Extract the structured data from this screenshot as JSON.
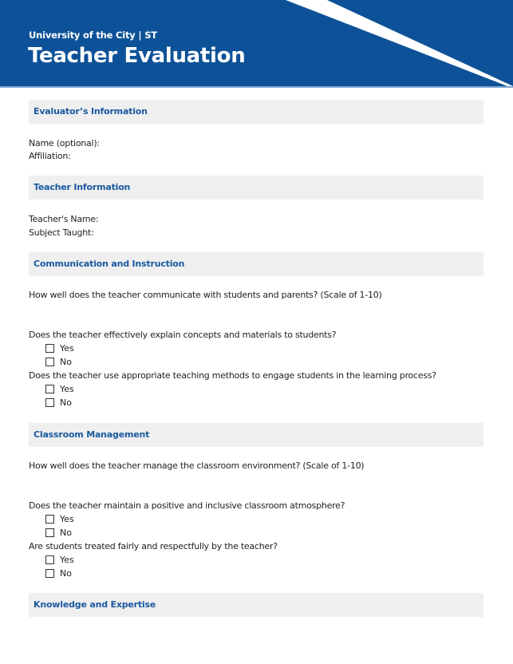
{
  "header": {
    "subtitle": "University of the City | ST",
    "title": "Teacher Evaluation",
    "brand_color": "#0d5298"
  },
  "sections": [
    {
      "title": "Evaluator’s Information",
      "fields": [
        "Name (optional):",
        "Affiliation:"
      ]
    },
    {
      "title": "Teacher Information",
      "fields": [
        "Teacher's Name:",
        "Subject Taught:"
      ]
    },
    {
      "title": "Communication and Instruction",
      "scale_question": "How well does the teacher communicate with students and parents? (Scale of 1-10)",
      "questions": [
        {
          "text": "Does the teacher effectively explain concepts and materials to students?",
          "options": [
            "Yes",
            "No"
          ]
        },
        {
          "text": "Does the teacher use appropriate teaching methods to engage students in the learning process?",
          "options": [
            "Yes",
            "No"
          ]
        }
      ]
    },
    {
      "title": "Classroom Management",
      "scale_question": "How well does the teacher manage the classroom environment? (Scale of 1-10)",
      "questions": [
        {
          "text": "Does the teacher maintain a positive and inclusive classroom atmosphere?",
          "options": [
            "Yes",
            "No"
          ]
        },
        {
          "text": "Are students treated fairly and respectfully by the teacher?",
          "options": [
            "Yes",
            "No"
          ]
        }
      ]
    },
    {
      "title": "Knowledge and Expertise"
    }
  ]
}
